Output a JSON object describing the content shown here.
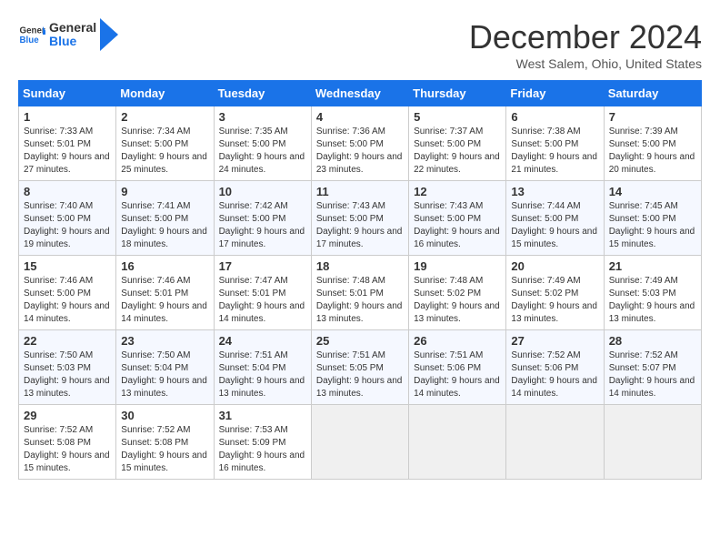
{
  "header": {
    "logo_general": "General",
    "logo_blue": "Blue",
    "month": "December 2024",
    "location": "West Salem, Ohio, United States"
  },
  "days_of_week": [
    "Sunday",
    "Monday",
    "Tuesday",
    "Wednesday",
    "Thursday",
    "Friday",
    "Saturday"
  ],
  "weeks": [
    [
      {
        "day": "1",
        "sunrise": "7:33 AM",
        "sunset": "5:01 PM",
        "daylight": "9 hours and 27 minutes."
      },
      {
        "day": "2",
        "sunrise": "7:34 AM",
        "sunset": "5:00 PM",
        "daylight": "9 hours and 25 minutes."
      },
      {
        "day": "3",
        "sunrise": "7:35 AM",
        "sunset": "5:00 PM",
        "daylight": "9 hours and 24 minutes."
      },
      {
        "day": "4",
        "sunrise": "7:36 AM",
        "sunset": "5:00 PM",
        "daylight": "9 hours and 23 minutes."
      },
      {
        "day": "5",
        "sunrise": "7:37 AM",
        "sunset": "5:00 PM",
        "daylight": "9 hours and 22 minutes."
      },
      {
        "day": "6",
        "sunrise": "7:38 AM",
        "sunset": "5:00 PM",
        "daylight": "9 hours and 21 minutes."
      },
      {
        "day": "7",
        "sunrise": "7:39 AM",
        "sunset": "5:00 PM",
        "daylight": "9 hours and 20 minutes."
      }
    ],
    [
      {
        "day": "8",
        "sunrise": "7:40 AM",
        "sunset": "5:00 PM",
        "daylight": "9 hours and 19 minutes."
      },
      {
        "day": "9",
        "sunrise": "7:41 AM",
        "sunset": "5:00 PM",
        "daylight": "9 hours and 18 minutes."
      },
      {
        "day": "10",
        "sunrise": "7:42 AM",
        "sunset": "5:00 PM",
        "daylight": "9 hours and 17 minutes."
      },
      {
        "day": "11",
        "sunrise": "7:43 AM",
        "sunset": "5:00 PM",
        "daylight": "9 hours and 17 minutes."
      },
      {
        "day": "12",
        "sunrise": "7:43 AM",
        "sunset": "5:00 PM",
        "daylight": "9 hours and 16 minutes."
      },
      {
        "day": "13",
        "sunrise": "7:44 AM",
        "sunset": "5:00 PM",
        "daylight": "9 hours and 15 minutes."
      },
      {
        "day": "14",
        "sunrise": "7:45 AM",
        "sunset": "5:00 PM",
        "daylight": "9 hours and 15 minutes."
      }
    ],
    [
      {
        "day": "15",
        "sunrise": "7:46 AM",
        "sunset": "5:00 PM",
        "daylight": "9 hours and 14 minutes."
      },
      {
        "day": "16",
        "sunrise": "7:46 AM",
        "sunset": "5:01 PM",
        "daylight": "9 hours and 14 minutes."
      },
      {
        "day": "17",
        "sunrise": "7:47 AM",
        "sunset": "5:01 PM",
        "daylight": "9 hours and 14 minutes."
      },
      {
        "day": "18",
        "sunrise": "7:48 AM",
        "sunset": "5:01 PM",
        "daylight": "9 hours and 13 minutes."
      },
      {
        "day": "19",
        "sunrise": "7:48 AM",
        "sunset": "5:02 PM",
        "daylight": "9 hours and 13 minutes."
      },
      {
        "day": "20",
        "sunrise": "7:49 AM",
        "sunset": "5:02 PM",
        "daylight": "9 hours and 13 minutes."
      },
      {
        "day": "21",
        "sunrise": "7:49 AM",
        "sunset": "5:03 PM",
        "daylight": "9 hours and 13 minutes."
      }
    ],
    [
      {
        "day": "22",
        "sunrise": "7:50 AM",
        "sunset": "5:03 PM",
        "daylight": "9 hours and 13 minutes."
      },
      {
        "day": "23",
        "sunrise": "7:50 AM",
        "sunset": "5:04 PM",
        "daylight": "9 hours and 13 minutes."
      },
      {
        "day": "24",
        "sunrise": "7:51 AM",
        "sunset": "5:04 PM",
        "daylight": "9 hours and 13 minutes."
      },
      {
        "day": "25",
        "sunrise": "7:51 AM",
        "sunset": "5:05 PM",
        "daylight": "9 hours and 13 minutes."
      },
      {
        "day": "26",
        "sunrise": "7:51 AM",
        "sunset": "5:06 PM",
        "daylight": "9 hours and 14 minutes."
      },
      {
        "day": "27",
        "sunrise": "7:52 AM",
        "sunset": "5:06 PM",
        "daylight": "9 hours and 14 minutes."
      },
      {
        "day": "28",
        "sunrise": "7:52 AM",
        "sunset": "5:07 PM",
        "daylight": "9 hours and 14 minutes."
      }
    ],
    [
      {
        "day": "29",
        "sunrise": "7:52 AM",
        "sunset": "5:08 PM",
        "daylight": "9 hours and 15 minutes."
      },
      {
        "day": "30",
        "sunrise": "7:52 AM",
        "sunset": "5:08 PM",
        "daylight": "9 hours and 15 minutes."
      },
      {
        "day": "31",
        "sunrise": "7:53 AM",
        "sunset": "5:09 PM",
        "daylight": "9 hours and 16 minutes."
      },
      null,
      null,
      null,
      null
    ]
  ],
  "labels": {
    "sunrise": "Sunrise:",
    "sunset": "Sunset:",
    "daylight": "Daylight:"
  }
}
